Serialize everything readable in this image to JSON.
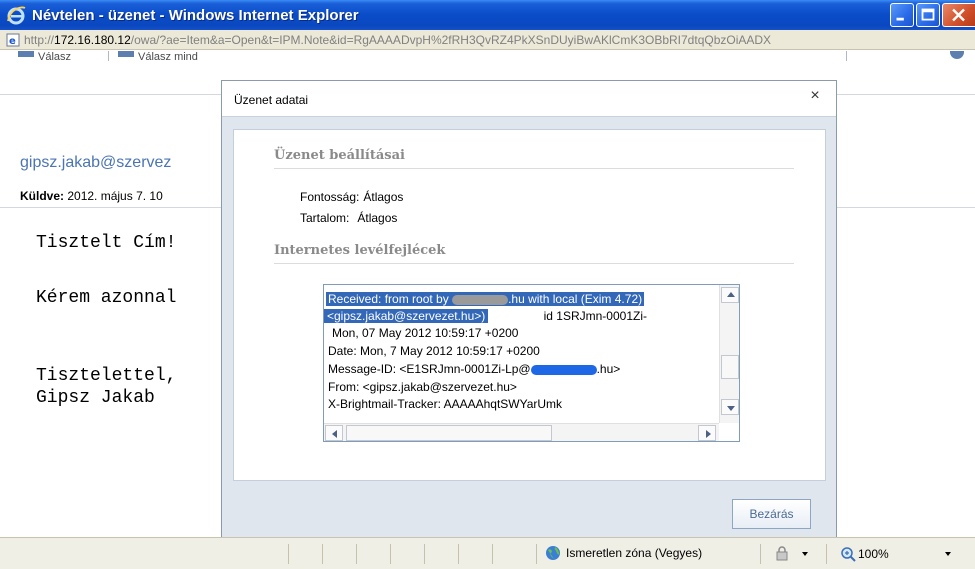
{
  "window": {
    "title": "Névtelen - üzenet - Windows Internet Explorer",
    "url_prefix": "http://",
    "url_host": "172.16.180.12",
    "url_rest": "/owa/?ae=Item&a=Open&t=IPM.Note&id=RgAAAADvpH%2fRH3QvRZ4PkXSnDUyiBwAKlCmK3OBbRI7dtqQbzOiAADX"
  },
  "toolbar": {
    "reply_label": "Válasz",
    "reply_all_label": "Válasz mind"
  },
  "message": {
    "sender": "gipsz.jakab@szervez",
    "sent_label": "Küldve:",
    "sent_value": "2012. május 7. 10",
    "body_lines": [
      "Tisztelt Cím!",
      "Kérem azonnal",
      "Tisztelettel,",
      "Gipsz Jakab"
    ]
  },
  "dialog": {
    "title": "Üzenet adatai",
    "close_glyph": "×",
    "settings_section": "Üzenet beállításai",
    "importance_label": "Fontosság:",
    "importance_value": "Átlagos",
    "sensitivity_label": "Tartalom:",
    "sensitivity_value": "Átlagos",
    "headers_section": "Internetes levélfejlécek",
    "headers": {
      "line1_a": "Received: from root by",
      "line1_b": ".hu with local (Exim 4.72)",
      "line2_a": "<gipsz.jakab@szervezet.hu>)",
      "line2_b": "id 1SRJmn-0001Zi-",
      "line3": "Mon, 07 May 2012 10:59:17 +0200",
      "line4": "Date: Mon, 7 May 2012 10:59:17 +0200",
      "line5_a": "Message-ID: <E1SRJmn-0001Zi-Lp@",
      "line5_b": ".hu>",
      "line6": "From: <gipsz.jakab@szervezet.hu>",
      "line7": "X-Brightmail-Tracker: AAAAAhqtSWYarUmk"
    },
    "close_button": "Bezárás"
  },
  "statusbar": {
    "zone_text": "Ismeretlen zóna (Vegyes)",
    "zoom_text": "100%"
  },
  "colors": {
    "titlebar": "#0a4cc8",
    "sender_link": "#4a74b4",
    "selection": "#3367b8",
    "redaction": "#1e68e6"
  }
}
